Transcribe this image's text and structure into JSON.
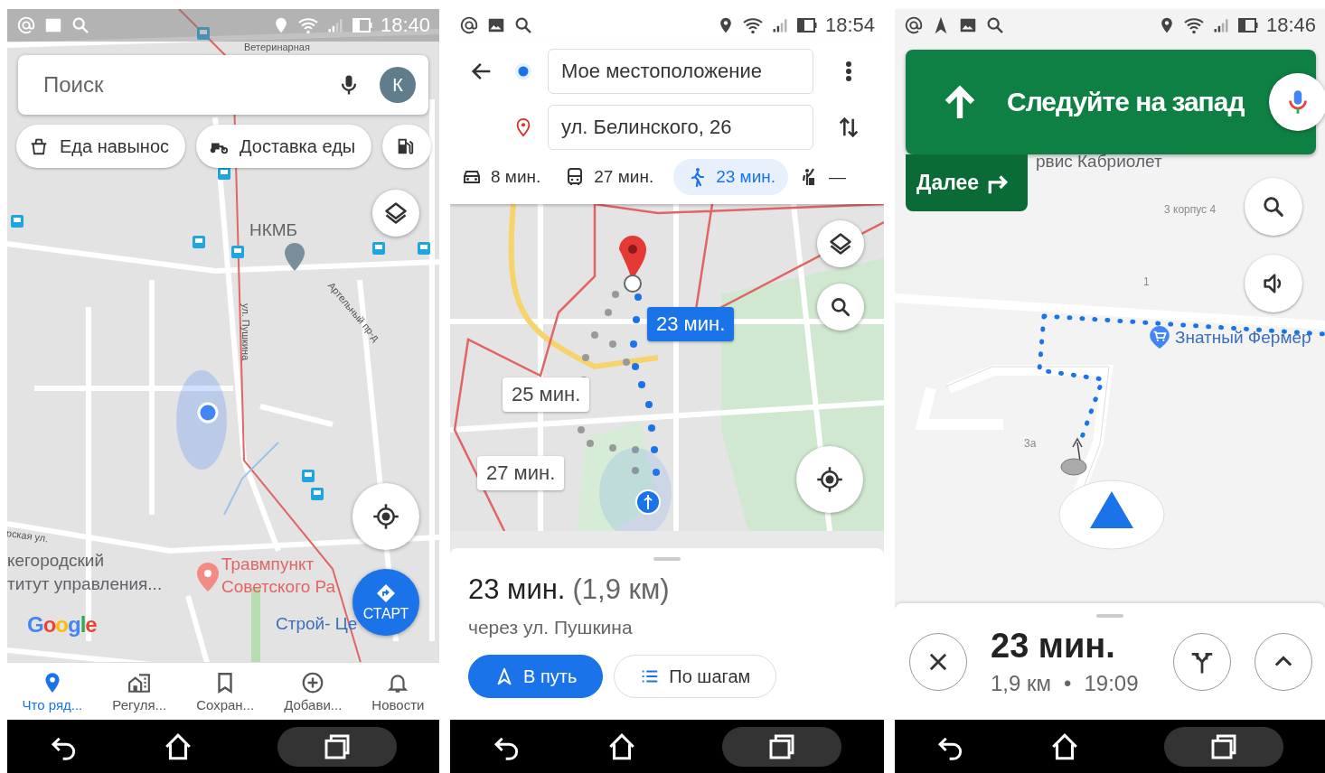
{
  "screen_1": {
    "status_time": "18:40",
    "map_labels": [
      {
        "text": "Ветеринарная",
        "kind": "street"
      },
      {
        "text": "НКМБ",
        "kind": "place"
      },
      {
        "text": "Артельный пр-д",
        "kind": "street"
      },
      {
        "text": "ул. Пушкина",
        "kind": "street"
      },
      {
        "text": "рская ул.",
        "kind": "street"
      },
      {
        "text": "кегородский",
        "kind": "place"
      },
      {
        "text": "титут управления...",
        "kind": "place"
      },
      {
        "text": "Травмпункт",
        "kind": "poi"
      },
      {
        "text": "Советского Ра",
        "kind": "poi"
      },
      {
        "text": "Строй- Це",
        "kind": "shop"
      }
    ],
    "search": {
      "placeholder": "Поиск",
      "avatar": "К"
    },
    "chips": [
      {
        "label": "Еда навынос",
        "kind": "takeaway"
      },
      {
        "label": "Доставка еды",
        "kind": "delivery"
      },
      {
        "kind": "fuel"
      }
    ],
    "google_logo": "Google",
    "start_button": "СТАРТ",
    "bottom_nav": [
      {
        "label": "Что ряд...",
        "kind": "explore",
        "selected": true
      },
      {
        "label": "Регуля...",
        "kind": "commute",
        "selected": false
      },
      {
        "label": "Сохран...",
        "kind": "saved",
        "selected": false
      },
      {
        "label": "Добави...",
        "kind": "contribute",
        "selected": false
      },
      {
        "label": "Новости",
        "kind": "updates",
        "selected": false
      }
    ]
  },
  "screen_2": {
    "status_time": "18:54",
    "origin": "Мое местоположение",
    "destination": "ул. Белинского, 26",
    "modes": [
      {
        "label": "8 мин.",
        "kind": "car",
        "selected": false
      },
      {
        "label": "27 мин.",
        "kind": "transit",
        "selected": false
      },
      {
        "label": "23 мин.",
        "kind": "walk",
        "selected": true
      },
      {
        "label": "—",
        "kind": "ride",
        "selected": false
      }
    ],
    "route_bubbles": [
      {
        "label": "23 мин.",
        "selected": true
      },
      {
        "label": "25 мин.",
        "selected": false
      },
      {
        "label": "27 мин.",
        "selected": false
      }
    ],
    "summary": {
      "duration": "23 мин.",
      "distance": "(1,9 км)",
      "via": "через ул. Пушкина"
    },
    "buttons": [
      {
        "label": "В путь",
        "kind": "primary"
      },
      {
        "label": "По шагам",
        "kind": "secondary"
      }
    ]
  },
  "screen_3": {
    "status_time": "18:46",
    "instruction": "Следуйте на запад",
    "next": "Далее",
    "map_labels": [
      {
        "text": "рвис Кабриолет",
        "kind": "place"
      },
      {
        "text": "3 корпус 4",
        "kind": "number"
      },
      {
        "text": "1",
        "kind": "number"
      },
      {
        "text": "Знатный Фермер",
        "kind": "shop"
      },
      {
        "text": "3а",
        "kind": "number"
      }
    ],
    "eta": {
      "duration": "23 мин.",
      "distance": "1,9 км",
      "separator": "•",
      "arrival": "19:09"
    }
  }
}
